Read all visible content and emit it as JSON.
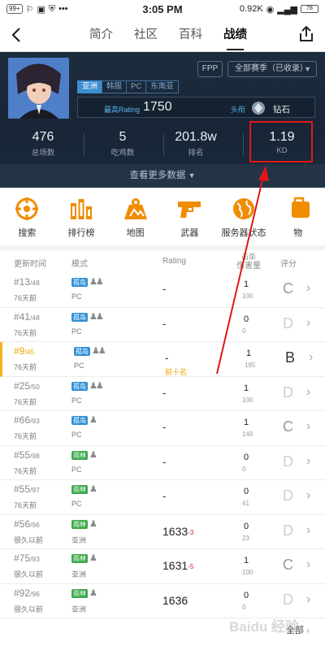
{
  "status_bar": {
    "badge": "99+",
    "time": "3:05 PM",
    "network": "0.92K",
    "battery": "78"
  },
  "nav": {
    "tabs": [
      {
        "label": "简介",
        "active": false
      },
      {
        "label": "社区",
        "active": false
      },
      {
        "label": "百科",
        "active": false
      },
      {
        "label": "战绩",
        "active": true
      }
    ]
  },
  "profile": {
    "mode_button": "FPP",
    "season_select": "全部赛季（已收录）",
    "regions": [
      {
        "label": "亚洲",
        "active": true
      },
      {
        "label": "韩服",
        "active": false
      },
      {
        "label": "PC",
        "active": false
      },
      {
        "label": "东南亚",
        "active": false
      }
    ],
    "rating_label": "最高Rating",
    "rating_value": "1750",
    "title_label": "头衔",
    "title_value": "钻石"
  },
  "stats": [
    {
      "value": "476",
      "label": "总场数"
    },
    {
      "value": "5",
      "label": "吃鸡数"
    },
    {
      "value": "201.8w",
      "label": "排名"
    },
    {
      "value": "1.19",
      "label": "KD"
    }
  ],
  "more_data": "查看更多数据",
  "quick_actions": [
    {
      "label": "搜索",
      "icon": "crosshair-icon"
    },
    {
      "label": "排行榜",
      "icon": "leaderboard-icon"
    },
    {
      "label": "地图",
      "icon": "map-icon"
    },
    {
      "label": "武器",
      "icon": "pistol-icon"
    },
    {
      "label": "服务器状态",
      "icon": "globe-icon"
    },
    {
      "label": "物",
      "icon": "item-icon"
    }
  ],
  "table": {
    "headers": {
      "time": "更新时间",
      "mode": "模式",
      "rating": "Rating",
      "kills_top": "击杀",
      "kills_bottom": "伤害量",
      "grade": "评分"
    },
    "rows": [
      {
        "rank": "#13",
        "total": "/48",
        "when": "76天前",
        "mode": "孤岛",
        "mode_color": "b",
        "people": "♟♟",
        "server": "PC",
        "rating": "-",
        "rating_delta": "",
        "top10": "",
        "kills": "1",
        "damage": "100",
        "grade": "C"
      },
      {
        "rank": "#41",
        "total": "/48",
        "when": "76天前",
        "mode": "孤岛",
        "mode_color": "b",
        "people": "♟♟",
        "server": "PC",
        "rating": "-",
        "rating_delta": "",
        "top10": "",
        "kills": "0",
        "damage": "0",
        "grade": "D"
      },
      {
        "rank": "#9",
        "total": "/45",
        "when": "76天前",
        "mode": "孤岛",
        "mode_color": "b",
        "people": "♟♟",
        "server": "PC",
        "rating": "-",
        "rating_delta": "",
        "top10": "前十名",
        "kills": "1",
        "damage": "185",
        "grade": "B"
      },
      {
        "rank": "#25",
        "total": "/50",
        "when": "76天前",
        "mode": "孤岛",
        "mode_color": "b",
        "people": "♟♟",
        "server": "PC",
        "rating": "-",
        "rating_delta": "",
        "top10": "",
        "kills": "1",
        "damage": "100",
        "grade": "D"
      },
      {
        "rank": "#66",
        "total": "/93",
        "when": "76天前",
        "mode": "孤岛",
        "mode_color": "b",
        "people": "♟",
        "server": "PC",
        "rating": "-",
        "rating_delta": "",
        "top10": "",
        "kills": "1",
        "damage": "149",
        "grade": "C"
      },
      {
        "rank": "#55",
        "total": "/98",
        "when": "76天前",
        "mode": "雨林",
        "mode_color": "g",
        "people": "♟",
        "server": "PC",
        "rating": "-",
        "rating_delta": "",
        "top10": "",
        "kills": "0",
        "damage": "0",
        "grade": "D"
      },
      {
        "rank": "#55",
        "total": "/97",
        "when": "76天前",
        "mode": "雨林",
        "mode_color": "g",
        "people": "♟",
        "server": "PC",
        "rating": "-",
        "rating_delta": "",
        "top10": "",
        "kills": "0",
        "damage": "41",
        "grade": "D"
      },
      {
        "rank": "#56",
        "total": "/96",
        "when": "很久以前",
        "mode": "雨林",
        "mode_color": "g",
        "people": "♟",
        "server": "亚洲",
        "rating": "1633",
        "rating_delta": "-3",
        "top10": "",
        "kills": "0",
        "damage": "23",
        "grade": "D"
      },
      {
        "rank": "#75",
        "total": "/93",
        "when": "很久以前",
        "mode": "雨林",
        "mode_color": "g",
        "people": "♟",
        "server": "亚洲",
        "rating": "1631",
        "rating_delta": "-5",
        "top10": "",
        "kills": "1",
        "damage": "100",
        "grade": "C"
      },
      {
        "rank": "#92",
        "total": "/96",
        "when": "很久以前",
        "mode": "雨林",
        "mode_color": "g",
        "people": "♟",
        "server": "亚洲",
        "rating": "1636",
        "rating_delta": "",
        "top10": "",
        "kills": "0",
        "damage": "0",
        "grade": "D"
      }
    ]
  },
  "footer": {
    "all_label": "全部"
  },
  "colors": {
    "accent": "#f08c00",
    "hero_bg": "#1e2d3e",
    "highlight": "#e01717",
    "region_active": "#3d8fd0"
  }
}
